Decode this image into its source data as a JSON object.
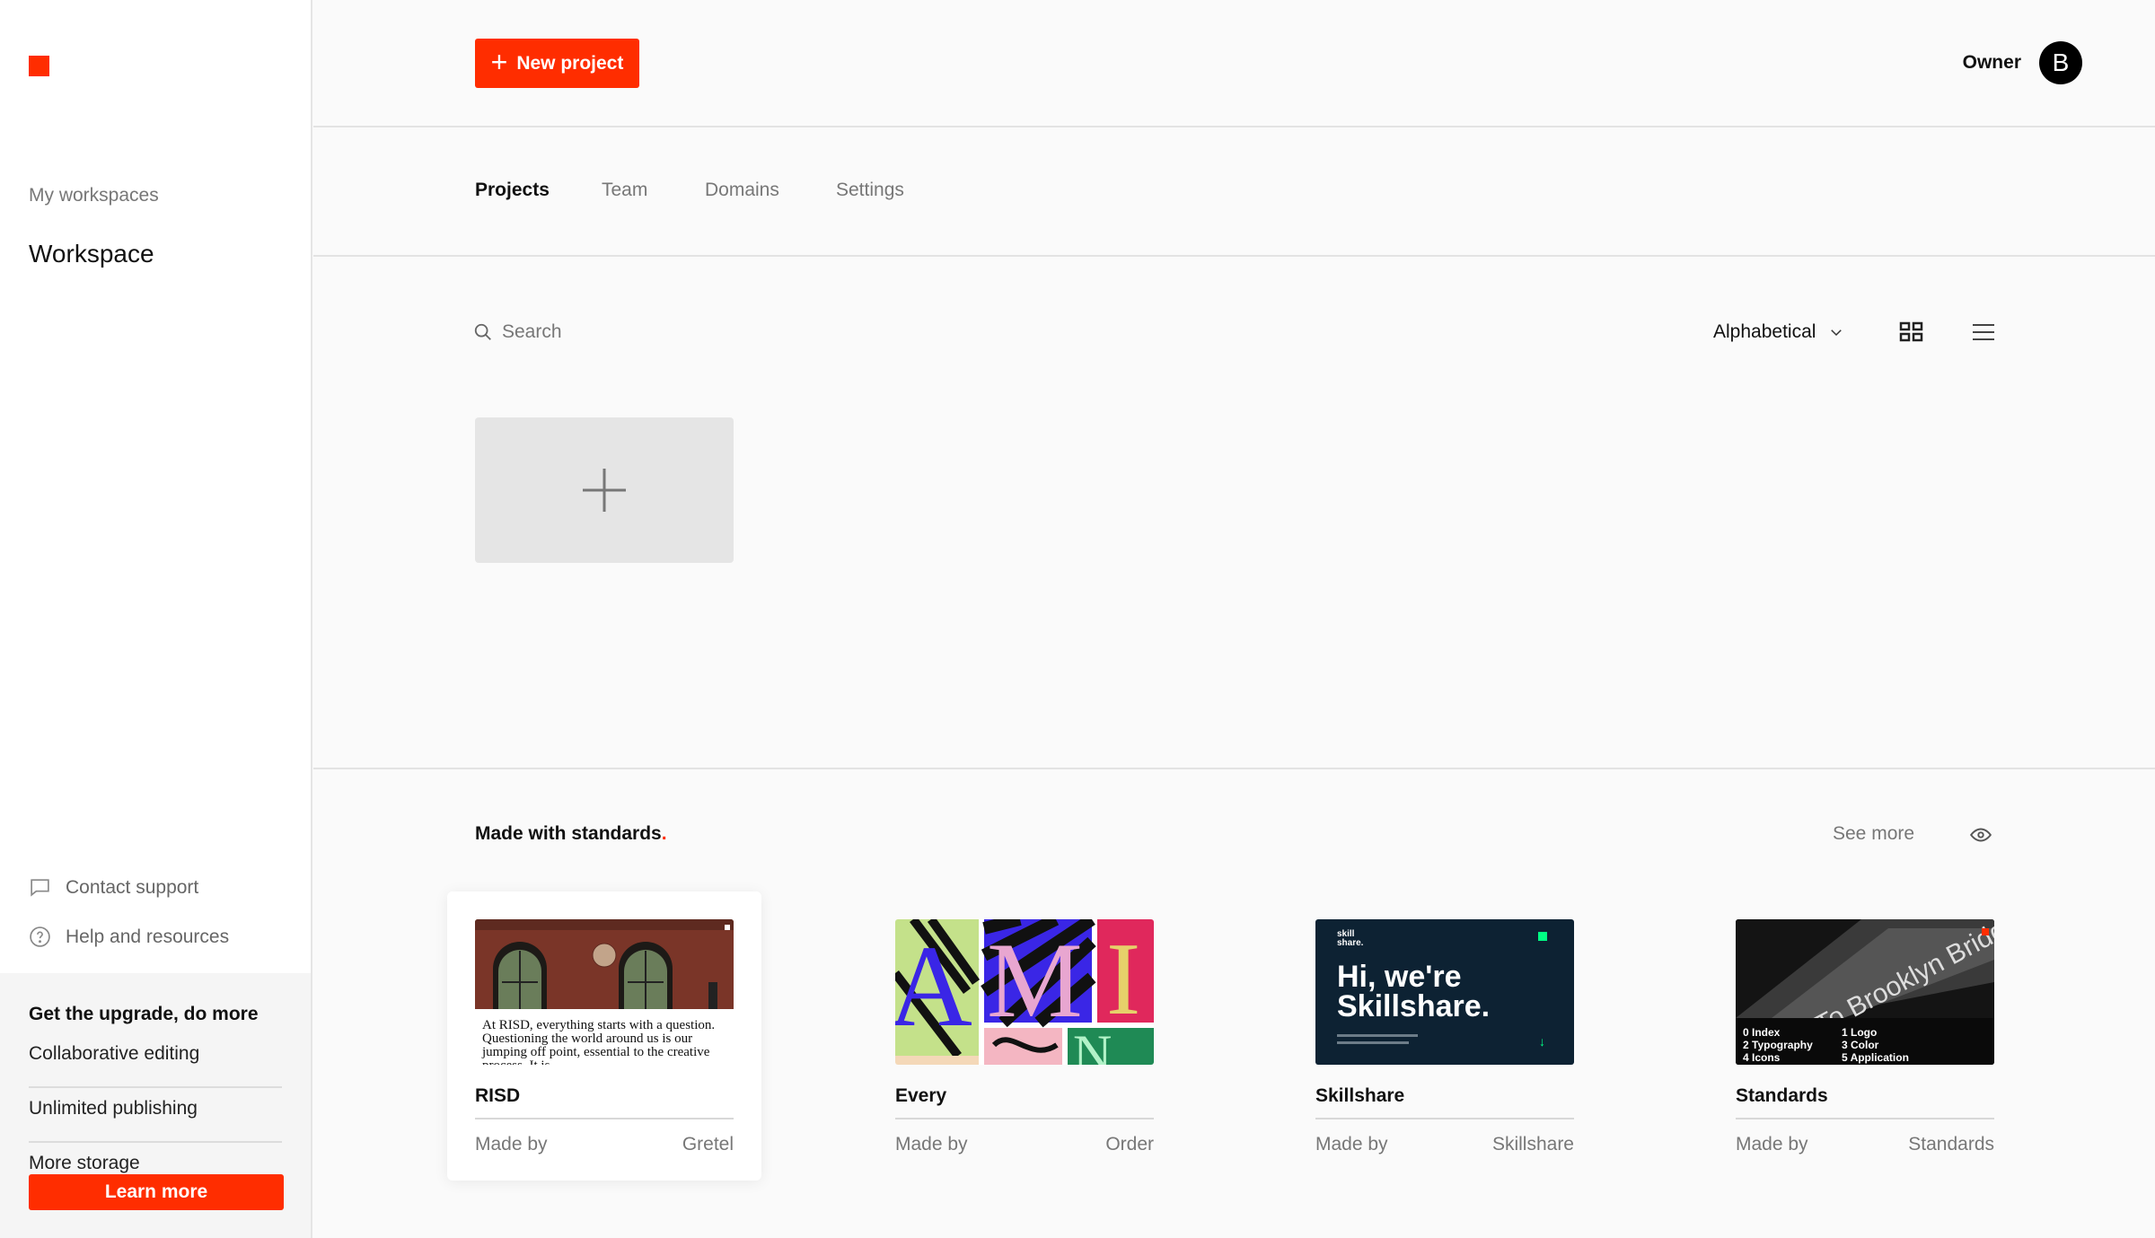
{
  "sidebar": {
    "workspaces_caption": "My workspaces",
    "workspace_name": "Workspace",
    "contact_support": "Contact support",
    "help_resources": "Help and resources",
    "upgrade": {
      "title": "Get the upgrade, do more",
      "features": [
        "Collaborative editing",
        "Unlimited publishing",
        "More storage"
      ],
      "button": "Learn more"
    }
  },
  "header": {
    "new_project": "New project",
    "role": "Owner",
    "avatar_initial": "B"
  },
  "tabs": [
    {
      "label": "Projects",
      "active": true
    },
    {
      "label": "Team",
      "active": false
    },
    {
      "label": "Domains",
      "active": false
    },
    {
      "label": "Settings",
      "active": false
    }
  ],
  "toolbar": {
    "search_placeholder": "Search",
    "sort_label": "Alphabetical"
  },
  "showcase": {
    "title": "Made with standards",
    "title_dot": ".",
    "see_more": "See more",
    "cards": [
      {
        "name": "RISD",
        "made_by_label": "Made by",
        "author": "Gretel",
        "thumb_text": "At RISD, everything starts with a question. Questioning the world around us is our jumping off point, essential to the creative process. It is"
      },
      {
        "name": "Every",
        "made_by_label": "Made by",
        "author": "Order"
      },
      {
        "name": "Skillshare",
        "made_by_label": "Made by",
        "author": "Skillshare",
        "thumb_headline": "Hi, we're Skillshare.",
        "thumb_logo": "skill share."
      },
      {
        "name": "Standards",
        "made_by_label": "Made by",
        "author": "Standards",
        "thumb_index": [
          "0 Index",
          "2 Typography",
          "4 Icons",
          "1 Logo",
          "3 Color",
          "5 Application"
        ],
        "thumb_sign": "To Brooklyn Bridge · Late nights to · stops here"
      }
    ]
  },
  "colors": {
    "accent": "#ff2d00",
    "skillshare_bg": "#0d2233",
    "skillshare_accent": "#00ff84"
  }
}
